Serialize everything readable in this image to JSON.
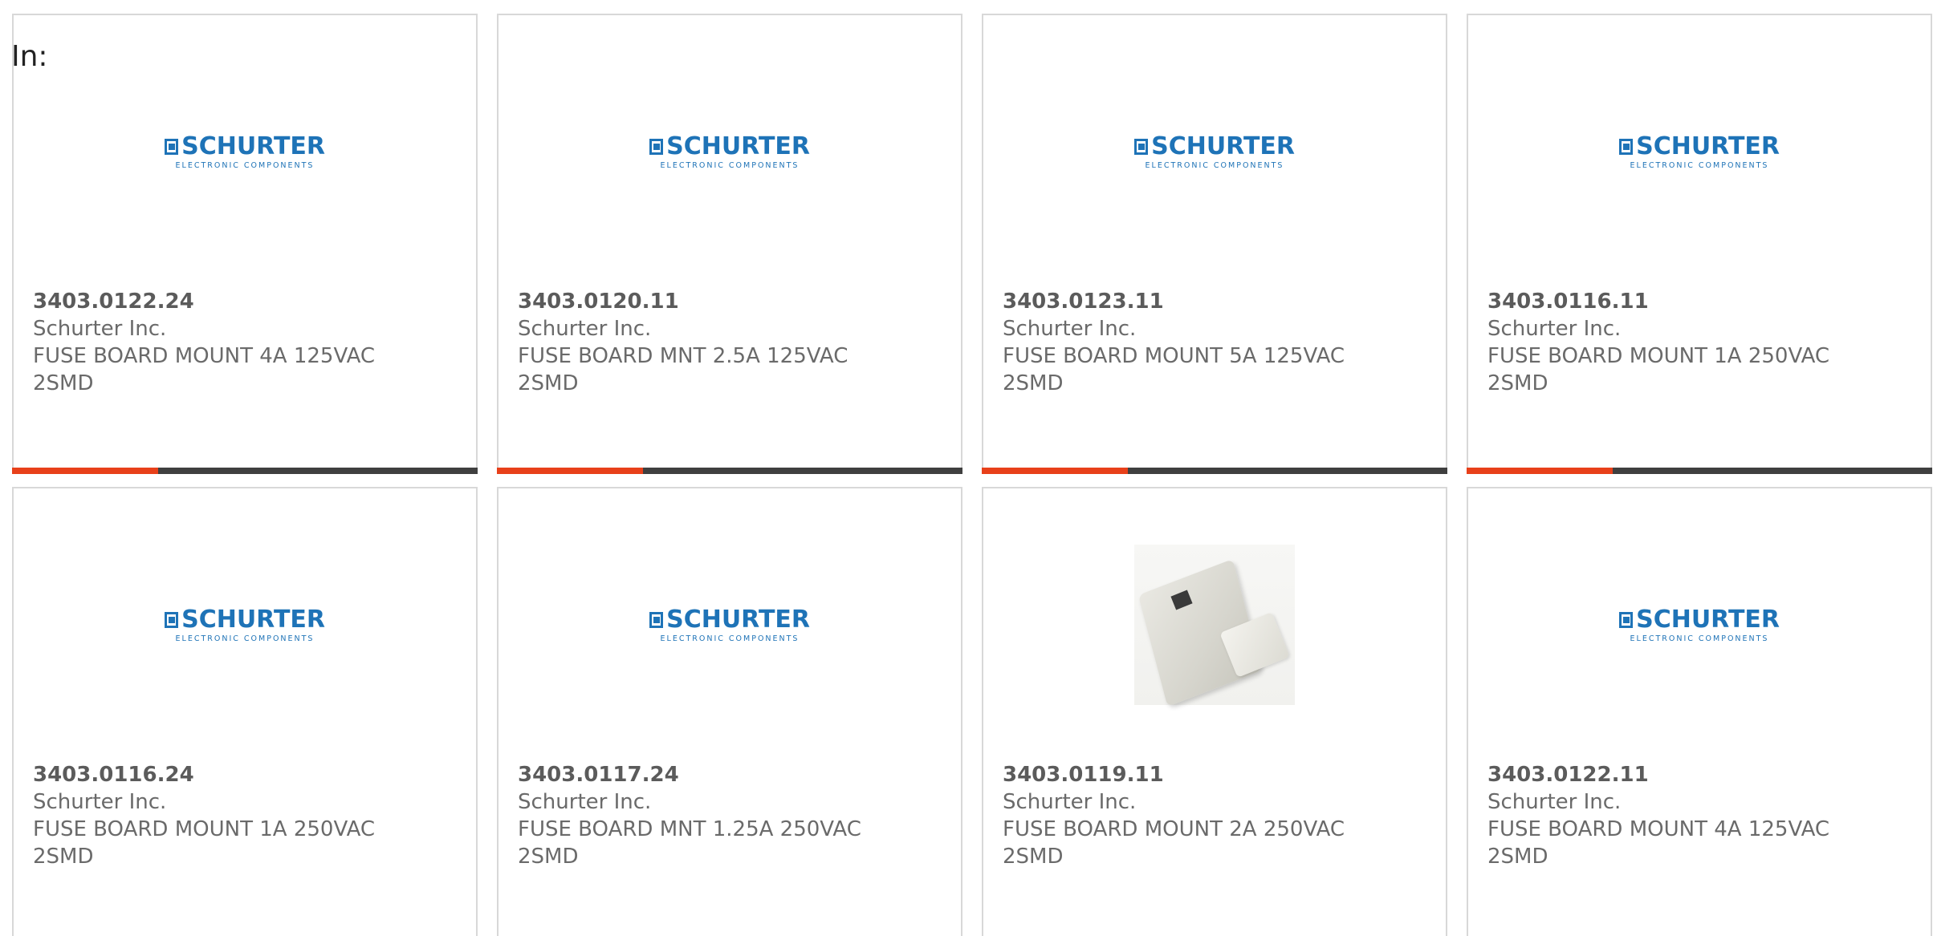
{
  "header": {
    "in_label": "In:"
  },
  "colors": {
    "accent": "#e8401a",
    "bar": "#3f3f3f",
    "logo_blue": "#1e73b7",
    "card_border": "#d8d8d8"
  },
  "logo": {
    "main": "SCHURTER",
    "sub": "ELECTRONIC COMPONENTS"
  },
  "products": [
    {
      "part_number": "3403.0122.24",
      "manufacturer": "Schurter Inc.",
      "description": "FUSE BOARD MOUNT 4A 125VAC 2SMD",
      "image": "schurter-logo"
    },
    {
      "part_number": "3403.0120.11",
      "manufacturer": "Schurter Inc.",
      "description": "FUSE BOARD MNT 2.5A 125VAC 2SMD",
      "image": "schurter-logo"
    },
    {
      "part_number": "3403.0123.11",
      "manufacturer": "Schurter Inc.",
      "description": "FUSE BOARD MOUNT 5A 125VAC 2SMD",
      "image": "schurter-logo"
    },
    {
      "part_number": "3403.0116.11",
      "manufacturer": "Schurter Inc.",
      "description": "FUSE BOARD MOUNT 1A 250VAC 2SMD",
      "image": "schurter-logo"
    },
    {
      "part_number": "3403.0116.24",
      "manufacturer": "Schurter Inc.",
      "description": "FUSE BOARD MOUNT 1A 250VAC 2SMD",
      "image": "schurter-logo"
    },
    {
      "part_number": "3403.0117.24",
      "manufacturer": "Schurter Inc.",
      "description": "FUSE BOARD MNT 1.25A 250VAC 2SMD",
      "image": "schurter-logo"
    },
    {
      "part_number": "3403.0119.11",
      "manufacturer": "Schurter Inc.",
      "description": "FUSE BOARD MOUNT 2A 250VAC 2SMD",
      "image": "product-photo"
    },
    {
      "part_number": "3403.0122.11",
      "manufacturer": "Schurter Inc.",
      "description": "FUSE BOARD MOUNT 4A 125VAC 2SMD",
      "image": "schurter-logo"
    }
  ]
}
